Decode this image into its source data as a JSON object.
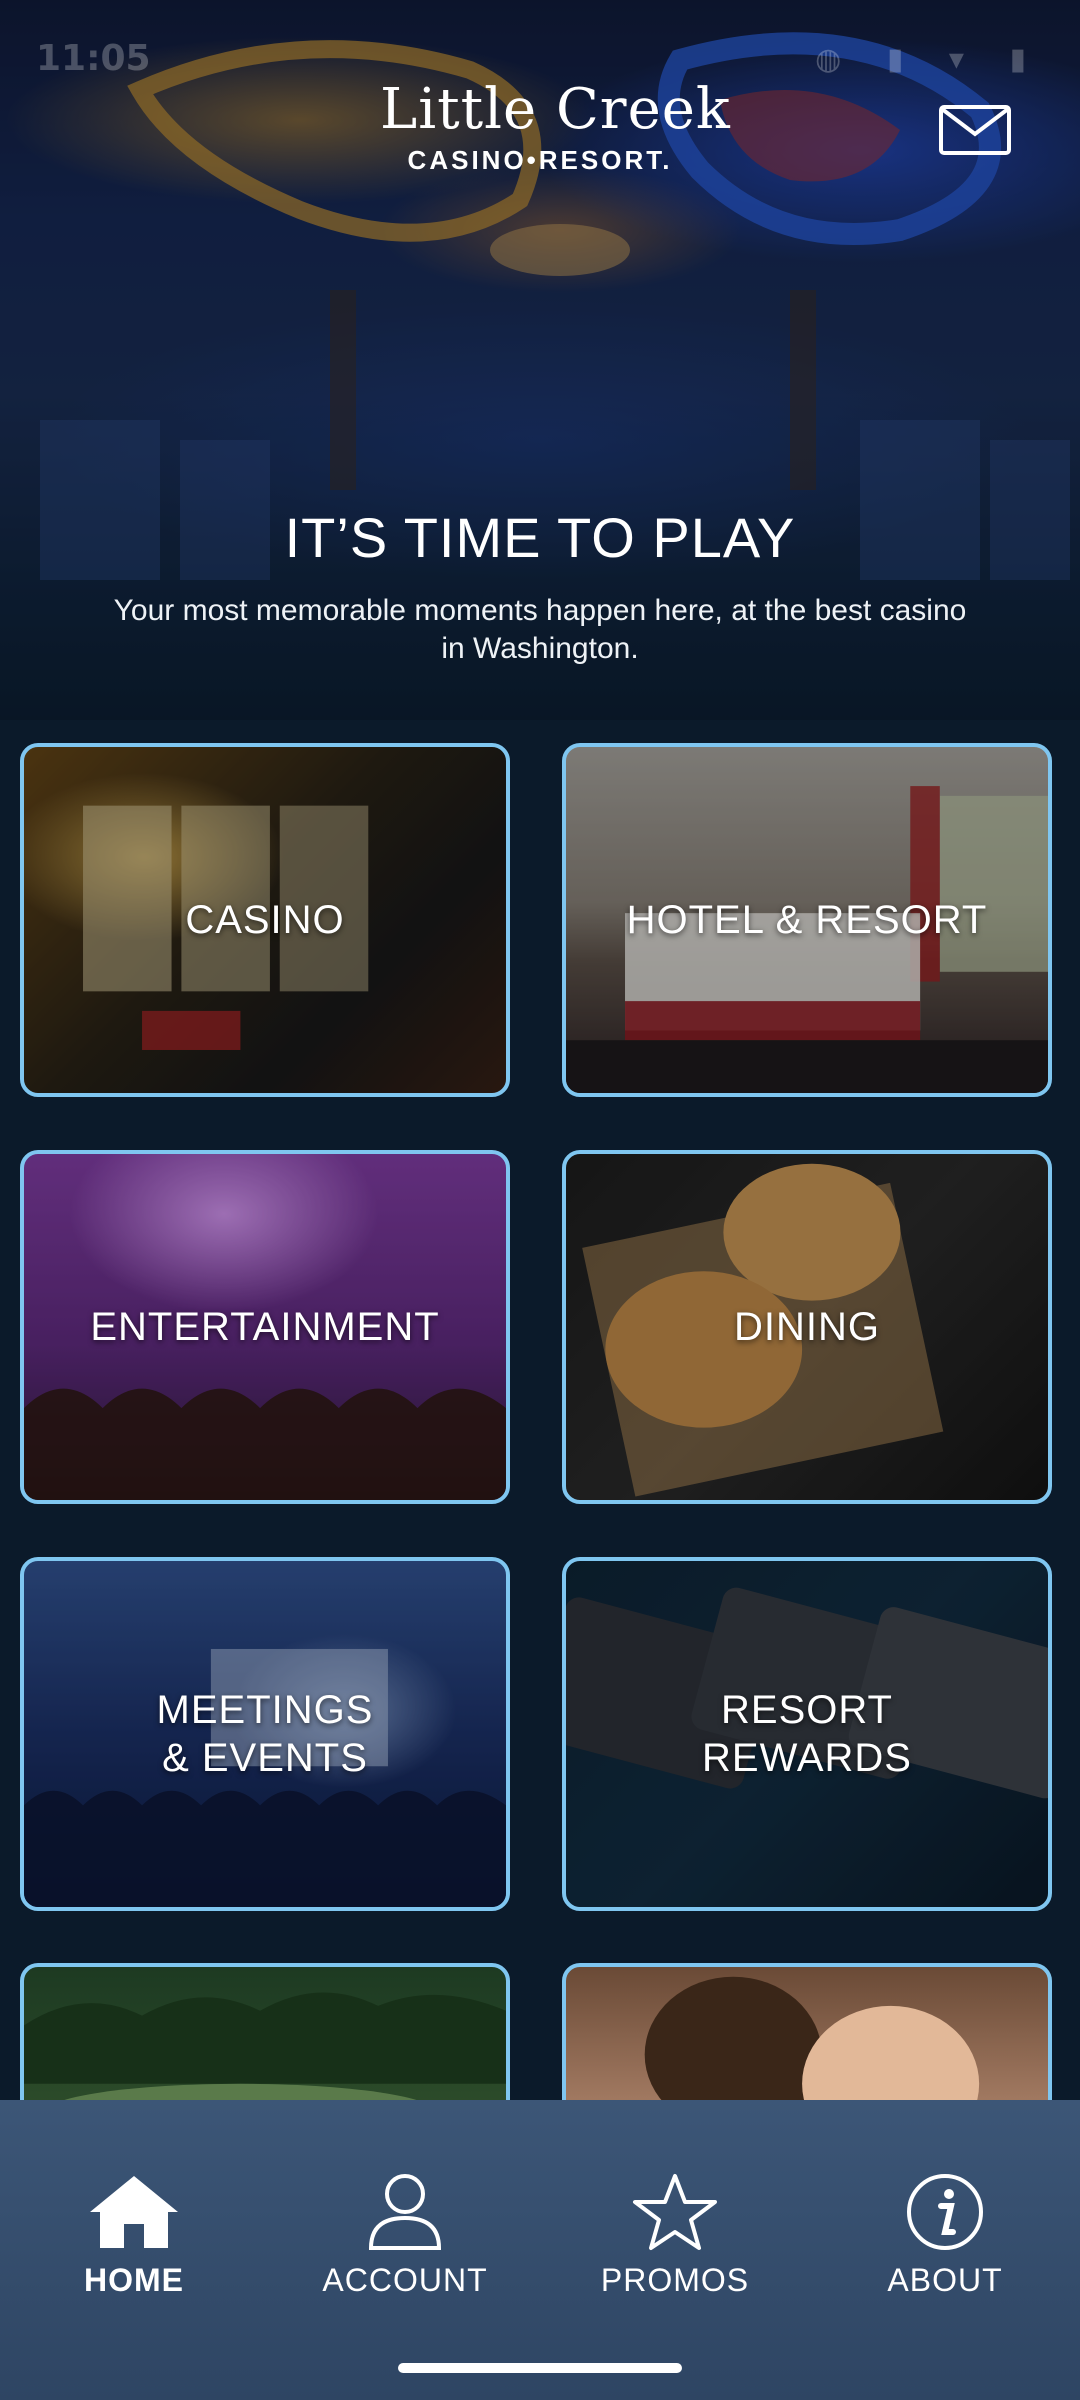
{
  "status_bar": {
    "time": "11:05"
  },
  "logo": {
    "line1": "Little Creek",
    "line2": "CASINO•RESORT."
  },
  "header": {
    "mail_icon": "mail-icon"
  },
  "hero": {
    "headline": "IT’S TIME TO PLAY",
    "subhead": "Your most memorable moments happen here, at the best casino in Washington."
  },
  "tiles": [
    {
      "label": "CASINO"
    },
    {
      "label": "HOTEL & RESORT"
    },
    {
      "label": "ENTERTAINMENT"
    },
    {
      "label": "DINING"
    },
    {
      "label": "MEETINGS\n& EVENTS"
    },
    {
      "label": "RESORT\nREWARDS"
    },
    {
      "label": ""
    },
    {
      "label": ""
    }
  ],
  "bottom_nav": [
    {
      "label": "HOME",
      "icon": "home-icon",
      "active": true
    },
    {
      "label": "ACCOUNT",
      "icon": "person-icon",
      "active": false
    },
    {
      "label": "PROMOS",
      "icon": "star-icon",
      "active": false
    },
    {
      "label": "ABOUT",
      "icon": "info-icon",
      "active": false
    }
  ],
  "colors": {
    "tile_border": "#7fc6f0",
    "nav_bg": "#3c5677",
    "page_bg": "#0b1a2a"
  }
}
